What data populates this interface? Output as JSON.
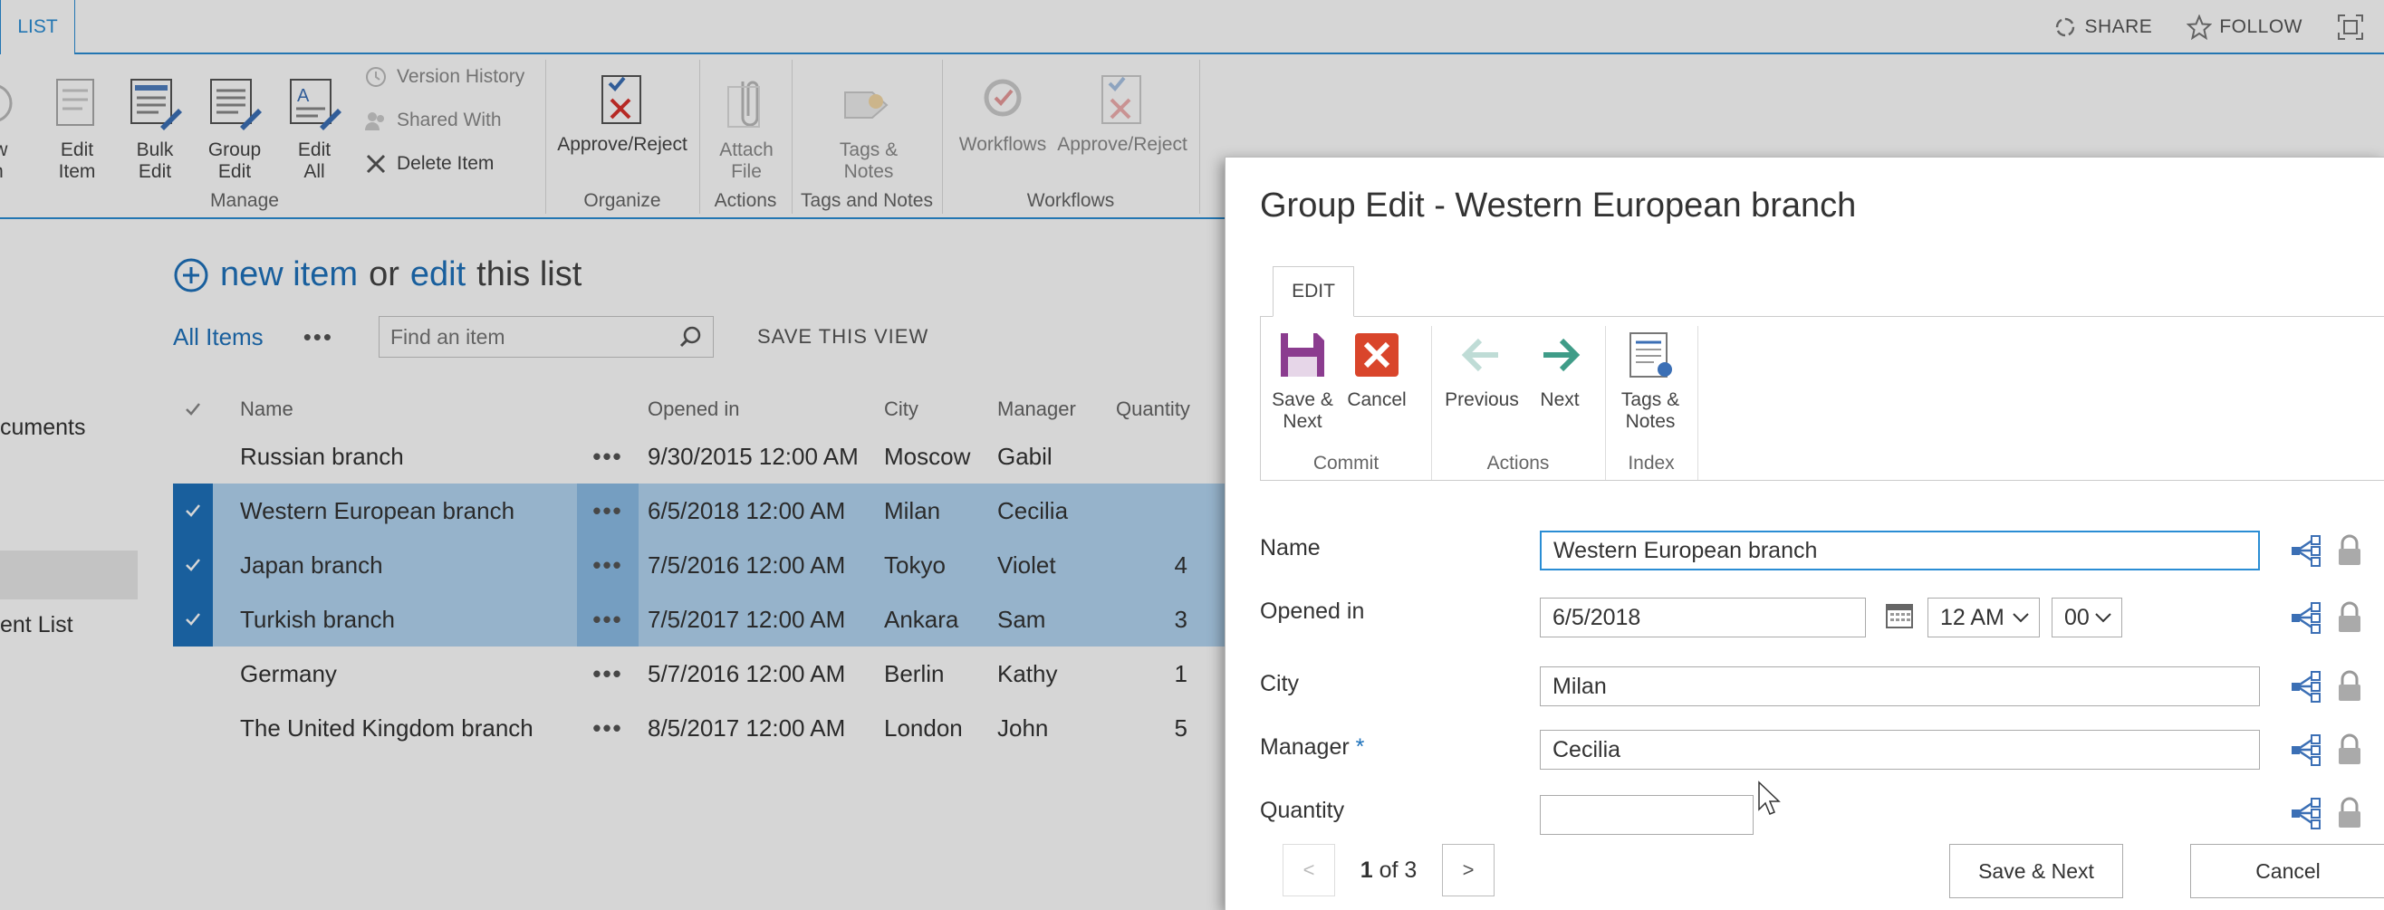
{
  "top_bar": {
    "tab": "LIST",
    "share": "SHARE",
    "follow": "FOLLOW"
  },
  "ribbon": {
    "new_item": "ew\nm",
    "edit_item": "Edit\nItem",
    "bulk_edit": "Bulk\nEdit",
    "group_edit": "Group\nEdit",
    "edit_all": "Edit\nAll",
    "version_history": "Version History",
    "shared_with": "Shared With",
    "delete_item": "Delete Item",
    "approve_reject": "Approve/Reject",
    "attach_file": "Attach\nFile",
    "tags_notes": "Tags &\nNotes",
    "workflows": "Workflows",
    "approve_reject_2": "Approve/Reject",
    "groups": {
      "manage": "Manage",
      "organize": "Organize",
      "actions": "Actions",
      "tags": "Tags and Notes",
      "workflows": "Workflows"
    }
  },
  "left_nav": {
    "documents": "cuments",
    "list": "ent List"
  },
  "list": {
    "new_item": "new item",
    "or": "or",
    "edit": "edit",
    "this_list": "this list",
    "all_items": "All Items",
    "more": "•••",
    "search_placeholder": "Find an item",
    "save_view": "SAVE THIS VIEW",
    "columns": {
      "name": "Name",
      "opened": "Opened in",
      "city": "City",
      "manager": "Manager",
      "quantity": "Quantity"
    },
    "rows": [
      {
        "name": "Russian branch",
        "opened": "9/30/2015 12:00 AM",
        "city": "Moscow",
        "manager": "Gabil",
        "quantity": "",
        "selected": false
      },
      {
        "name": "Western European branch",
        "opened": "6/5/2018 12:00 AM",
        "city": "Milan",
        "manager": "Cecilia",
        "quantity": "",
        "selected": true
      },
      {
        "name": "Japan branch",
        "opened": "7/5/2016 12:00 AM",
        "city": "Tokyo",
        "manager": "Violet",
        "quantity": "4",
        "selected": true
      },
      {
        "name": "Turkish branch",
        "opened": "7/5/2017 12:00 AM",
        "city": "Ankara",
        "manager": "Sam",
        "quantity": "3",
        "selected": true
      },
      {
        "name": "Germany",
        "opened": "5/7/2016 12:00 AM",
        "city": "Berlin",
        "manager": "Kathy",
        "quantity": "1",
        "selected": false
      },
      {
        "name": "The United Kingdom branch",
        "opened": "8/5/2017 12:00 AM",
        "city": "London",
        "manager": "John",
        "quantity": "5",
        "selected": false
      }
    ]
  },
  "dialog": {
    "title": "Group Edit - Western European branch",
    "tab": "EDIT",
    "buttons": {
      "save_next": "Save &\nNext",
      "cancel": "Cancel",
      "previous": "Previous",
      "next": "Next",
      "tags_notes": "Tags &\nNotes"
    },
    "groups": {
      "commit": "Commit",
      "actions": "Actions",
      "index": "Index"
    },
    "fields": {
      "name_label": "Name",
      "name_value": "Western European branch",
      "opened_label": "Opened in",
      "opened_date": "6/5/2018",
      "opened_hour": "12 AM",
      "opened_minute": "00",
      "city_label": "City",
      "city_value": "Milan",
      "manager_label": "Manager",
      "manager_required": "*",
      "manager_value": "Cecilia",
      "quantity_label": "Quantity",
      "quantity_value": ""
    },
    "pager": {
      "prev": "<",
      "current": "1",
      "of_total": "of 3",
      "next": ">"
    },
    "save_next_button": "Save & Next",
    "cancel_button": "Cancel"
  }
}
